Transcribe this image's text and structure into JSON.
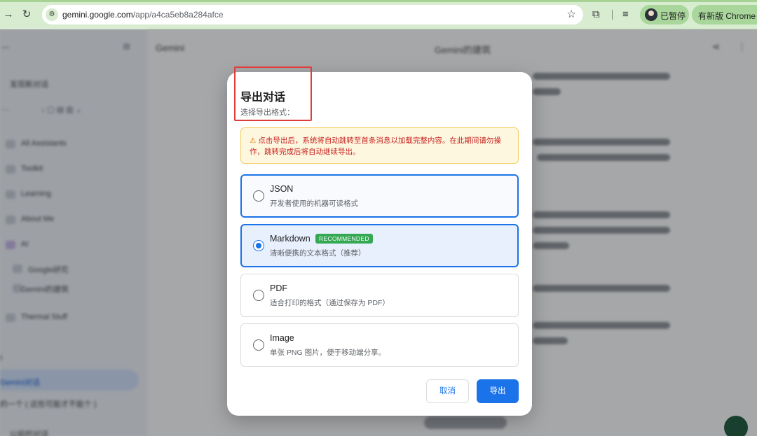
{
  "browser": {
    "url_host": "gemini.google.com",
    "url_path": "/app/a4ca5eb8a284afce",
    "profile_label": "已暂停",
    "update_label": "有新版 Chrome 可"
  },
  "background": {
    "sidebar_items": [
      "发现新对话",
      "All Assistants",
      "Toolkit",
      "Learning",
      "About Me",
      "AI",
      "Google研究",
      "Gemini的建筑",
      "Thermal Stuff",
      "Gemini对话",
      "的一个 ( 这些可能才不能个 )",
      "以前的对话"
    ],
    "page_left_title": "Gemini",
    "page_center_title": "Gemini的建筑"
  },
  "dialog": {
    "title": "导出对话",
    "subtitle": "选择导出格式：",
    "warning": "点击导出后，系统将自动跳转至首条消息以加载完整内容。在此期间请勿操作，跳转完成后将自动继续导出。",
    "options": [
      {
        "title": "JSON",
        "description": "开发者使用的机器可读格式",
        "badge": ""
      },
      {
        "title": "Markdown",
        "description": "清晰便携的文本格式（推荐）",
        "badge": "RECOMMENDED"
      },
      {
        "title": "PDF",
        "description": "适合打印的格式（通过保存为 PDF）",
        "badge": ""
      },
      {
        "title": "Image",
        "description": "单张 PNG 图片，便于移动端分享。",
        "badge": ""
      }
    ],
    "selected_format": "Markdown",
    "cancel_label": "取消",
    "export_label": "导出"
  },
  "colors": {
    "accent": "#1a73e8",
    "badge_green": "#34a853",
    "warning_text": "#c5221f",
    "warning_bg": "#fef7e0",
    "annotation_red": "#e03c3c",
    "browser_bar": "#d8ecd0"
  },
  "icons": [
    "back-arrow-icon",
    "reload-icon",
    "site-info-icon",
    "bookmark-star-icon",
    "extensions-icon",
    "reading-list-icon",
    "warning-icon",
    "radio-icon"
  ]
}
